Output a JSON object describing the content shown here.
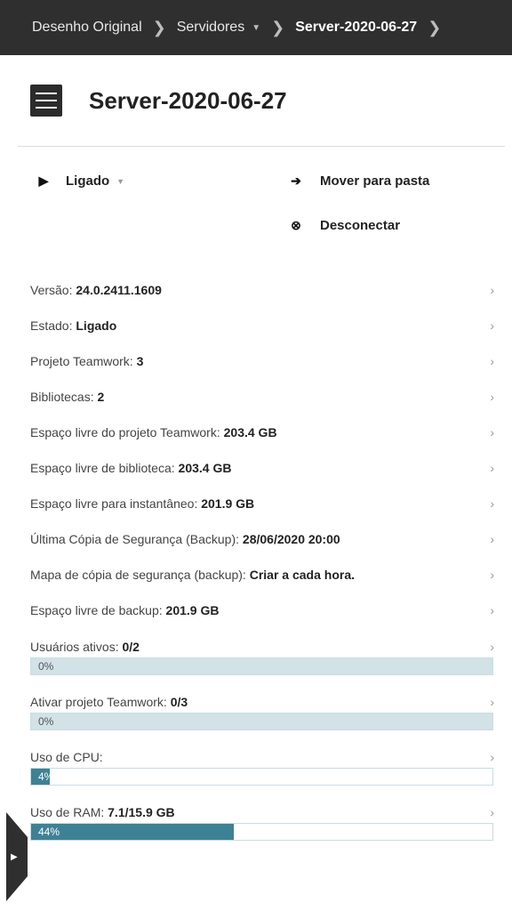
{
  "breadcrumb": {
    "items": [
      {
        "label": "Desenho Original"
      },
      {
        "label": "Servidores"
      },
      {
        "label": "Server-2020-06-27"
      }
    ]
  },
  "header": {
    "title": "Server-2020-06-27",
    "icon": "server-list-icon"
  },
  "actions": {
    "power": {
      "label": "Ligado",
      "icon": "play-icon"
    },
    "move": {
      "label": "Mover para pasta",
      "icon": "arrow-right-icon"
    },
    "disconnect": {
      "label": "Desconectar",
      "icon": "disconnect-icon"
    }
  },
  "info": {
    "version": {
      "label": "Versão: ",
      "value": "24.0.2411.1609"
    },
    "state": {
      "label": "Estado: ",
      "value": "Ligado"
    },
    "teamwork_projects": {
      "label": "Projeto Teamwork: ",
      "value": "3"
    },
    "libraries": {
      "label": "Bibliotecas: ",
      "value": "2"
    },
    "teamwork_free": {
      "label": "Espaço livre do projeto Teamwork: ",
      "value": "203.4 GB"
    },
    "library_free": {
      "label": "Espaço livre de biblioteca: ",
      "value": "203.4 GB"
    },
    "snapshot_free": {
      "label": "Espaço livre para instantâneo: ",
      "value": "201.9 GB"
    },
    "last_backup": {
      "label": "Última Cópia de Segurança (Backup): ",
      "value": "28/06/2020 20:00"
    },
    "backup_schedule": {
      "label": "Mapa de cópia de segurança (backup): ",
      "value": "Criar a cada hora."
    },
    "backup_free": {
      "label": "Espaço livre de backup: ",
      "value": "201.9 GB"
    }
  },
  "usage": {
    "active_users": {
      "label": "Usuários ativos: ",
      "value": "0/2",
      "percent_text": "0%",
      "fraction": 0
    },
    "active_projects": {
      "label": "Ativar projeto Teamwork: ",
      "value": "0/3",
      "percent_text": "0%",
      "fraction": 0
    },
    "cpu": {
      "label": "Uso de CPU:",
      "value": "",
      "percent_text": "4%",
      "fraction": 0.04
    },
    "ram": {
      "label": "Uso de RAM: ",
      "value": "7.1/15.9 GB",
      "percent_text": "44%",
      "fraction": 0.44
    }
  },
  "colors": {
    "bar_fill": "#3f8194",
    "bar_empty": "#d2e2e7",
    "topbar": "#2f2f2f"
  }
}
